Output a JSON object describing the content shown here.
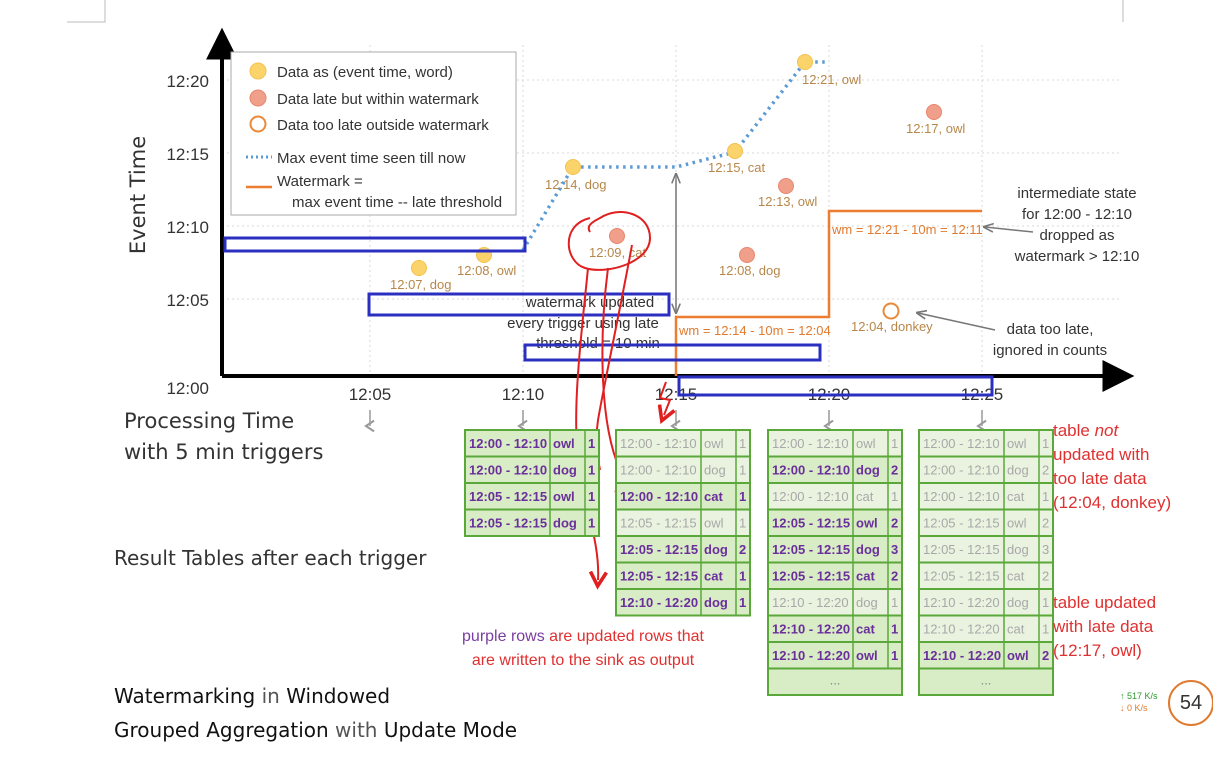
{
  "axes": {
    "y_title": "Event Time",
    "y_ticks": [
      "12:00",
      "12:05",
      "12:10",
      "12:15",
      "12:20"
    ],
    "x_ticks": [
      "12:05",
      "12:10",
      "12:15",
      "12:20",
      "12:25"
    ],
    "x_title_line1": "Processing Time",
    "x_title_line2": "with 5 min triggers"
  },
  "legend": {
    "item1": "Data as (event time, word)",
    "item2": "Data late but within watermark",
    "item3": "Data too late outside watermark",
    "item4": "Max event time seen till now",
    "item5a": "Watermark =",
    "item5b": "max event time -- late threshold"
  },
  "points": {
    "p1": "12:07, dog",
    "p2": "12:08, owl",
    "p3": "12:14, dog",
    "p4": "12:09, cat",
    "p5": "12:15, cat",
    "p6": "12:21, owl",
    "p7": "12:13, owl",
    "p8": "12:08, dog",
    "p9": "12:17, owl",
    "p10": "12:04, donkey"
  },
  "annotations": {
    "wm_updated_1": "watermark updated",
    "wm_updated_2": "every trigger using late",
    "wm_updated_3": "threshold = 10 min",
    "wm1": "wm = 12:14 - 10m = 12:04",
    "wm2": "wm = 12:21 - 10m = 12:11",
    "inter1": "intermediate state",
    "inter2": "for 12:00 - 12:10",
    "inter3": "dropped as",
    "inter4": "watermark > 12:10",
    "late1": "data too late,",
    "late2": "ignored in counts"
  },
  "tables": {
    "t1": [
      {
        "w": "12:00 - 12:10",
        "k": "owl",
        "c": "1",
        "s": "upd"
      },
      {
        "w": "12:00 - 12:10",
        "k": "dog",
        "c": "1",
        "s": "upd"
      },
      {
        "w": "12:05 - 12:15",
        "k": "owl",
        "c": "1",
        "s": "upd"
      },
      {
        "w": "12:05 - 12:15",
        "k": "dog",
        "c": "1",
        "s": "upd"
      }
    ],
    "t2": [
      {
        "w": "12:00 - 12:10",
        "k": "owl",
        "c": "1",
        "s": "old"
      },
      {
        "w": "12:00 - 12:10",
        "k": "dog",
        "c": "1",
        "s": "old"
      },
      {
        "w": "12:00 - 12:10",
        "k": "cat",
        "c": "1",
        "s": "upd"
      },
      {
        "w": "12:05 - 12:15",
        "k": "owl",
        "c": "1",
        "s": "old"
      },
      {
        "w": "12:05 - 12:15",
        "k": "dog",
        "c": "2",
        "s": "upd"
      },
      {
        "w": "12:05 - 12:15",
        "k": "cat",
        "c": "1",
        "s": "upd"
      },
      {
        "w": "12:10 - 12:20",
        "k": "dog",
        "c": "1",
        "s": "upd"
      }
    ],
    "t3": [
      {
        "w": "12:00 - 12:10",
        "k": "owl",
        "c": "1",
        "s": "old"
      },
      {
        "w": "12:00 - 12:10",
        "k": "dog",
        "c": "2",
        "s": "upd"
      },
      {
        "w": "12:00 - 12:10",
        "k": "cat",
        "c": "1",
        "s": "old"
      },
      {
        "w": "12:05 - 12:15",
        "k": "owl",
        "c": "2",
        "s": "upd"
      },
      {
        "w": "12:05 - 12:15",
        "k": "dog",
        "c": "3",
        "s": "upd"
      },
      {
        "w": "12:05 - 12:15",
        "k": "cat",
        "c": "2",
        "s": "upd"
      },
      {
        "w": "12:10 - 12:20",
        "k": "dog",
        "c": "1",
        "s": "old"
      },
      {
        "w": "12:10 - 12:20",
        "k": "cat",
        "c": "1",
        "s": "upd"
      },
      {
        "w": "12:10 - 12:20",
        "k": "owl",
        "c": "1",
        "s": "upd"
      }
    ],
    "t4": [
      {
        "w": "12:00 - 12:10",
        "k": "owl",
        "c": "1",
        "s": "old"
      },
      {
        "w": "12:00 - 12:10",
        "k": "dog",
        "c": "2",
        "s": "old"
      },
      {
        "w": "12:00 - 12:10",
        "k": "cat",
        "c": "1",
        "s": "old"
      },
      {
        "w": "12:05 - 12:15",
        "k": "owl",
        "c": "2",
        "s": "old"
      },
      {
        "w": "12:05 - 12:15",
        "k": "dog",
        "c": "3",
        "s": "old"
      },
      {
        "w": "12:05 - 12:15",
        "k": "cat",
        "c": "2",
        "s": "old"
      },
      {
        "w": "12:10 - 12:20",
        "k": "dog",
        "c": "1",
        "s": "old"
      },
      {
        "w": "12:10 - 12:20",
        "k": "cat",
        "c": "1",
        "s": "old"
      },
      {
        "w": "12:10 - 12:20",
        "k": "owl",
        "c": "2",
        "s": "upd"
      }
    ],
    "ellipsis": "..."
  },
  "text": {
    "result_tables": "Result Tables after each trigger",
    "purple_a": "purple rows",
    "purple_b": " are updated rows that",
    "purple_c": "are written to the sink as output",
    "not_upd_1": "table ",
    "not_upd_not": "not",
    "not_upd_2": "updated with",
    "not_upd_3": "too late data",
    "not_upd_4": "(12:04, donkey)",
    "upd_1": "table updated",
    "upd_2": "with late data",
    "upd_3": "(12:17, owl)",
    "title_1a": "Watermarking",
    "title_1b": " in ",
    "title_1c": "Windowed",
    "title_2a": "Grouped Aggregation",
    "title_2b": " with ",
    "title_2c": "Update Mode"
  },
  "widget": {
    "up": "↑ 517 K/s",
    "down": "↓ 0   K/s",
    "badge": "54"
  }
}
